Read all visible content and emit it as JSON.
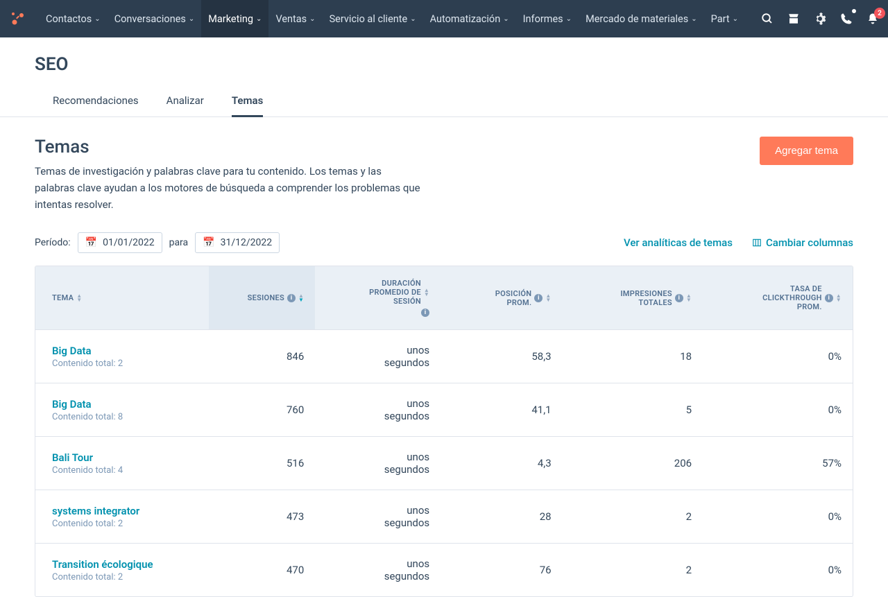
{
  "nav": {
    "items": [
      {
        "label": "Contactos"
      },
      {
        "label": "Conversaciones"
      },
      {
        "label": "Marketing",
        "active": true
      },
      {
        "label": "Ventas"
      },
      {
        "label": "Servicio al cliente"
      },
      {
        "label": "Automatización"
      },
      {
        "label": "Informes"
      },
      {
        "label": "Mercado de materiales"
      },
      {
        "label": "Part"
      }
    ],
    "notif_count": "2"
  },
  "page": {
    "title": "SEO",
    "tabs": [
      {
        "label": "Recomendaciones"
      },
      {
        "label": "Analizar"
      },
      {
        "label": "Temas",
        "active": true
      }
    ]
  },
  "section": {
    "title": "Temas",
    "description": "Temas de investigación y palabras clave para tu contenido. Los temas y las palabras clave ayudan a los motores de búsqueda a comprender los problemas que intentas resolver.",
    "add_button": "Agregar tema"
  },
  "controls": {
    "period_label": "Período:",
    "date_from": "01/01/2022",
    "to_label": "para",
    "date_to": "31/12/2022",
    "analytics_link": "Ver analíticas de temas",
    "columns_link": "Cambiar columnas"
  },
  "table": {
    "headers": {
      "topic": "TEMA",
      "sessions": "SESIONES",
      "duration": "DURACIÓN PROMEDIO DE SESIÓN",
      "position": "POSICIÓN PROM.",
      "impressions": "IMPRESIONES TOTALES",
      "ctr": "TASA DE CLICKTHROUGH PROM."
    },
    "content_prefix": "Contenido total: ",
    "rows": [
      {
        "name": "Big Data",
        "content": "2",
        "sessions": "846",
        "duration": "unos segundos",
        "position": "58,3",
        "impressions": "18",
        "ctr": "0%"
      },
      {
        "name": "Big Data",
        "content": "8",
        "sessions": "760",
        "duration": "unos segundos",
        "position": "41,1",
        "impressions": "5",
        "ctr": "0%"
      },
      {
        "name": "Bali Tour",
        "content": "4",
        "sessions": "516",
        "duration": "unos segundos",
        "position": "4,3",
        "impressions": "206",
        "ctr": "57%"
      },
      {
        "name": "systems integrator",
        "content": "2",
        "sessions": "473",
        "duration": "unos segundos",
        "position": "28",
        "impressions": "2",
        "ctr": "0%"
      },
      {
        "name": "Transition écologique",
        "content": "2",
        "sessions": "470",
        "duration": "unos segundos",
        "position": "76",
        "impressions": "2",
        "ctr": "0%"
      }
    ]
  }
}
